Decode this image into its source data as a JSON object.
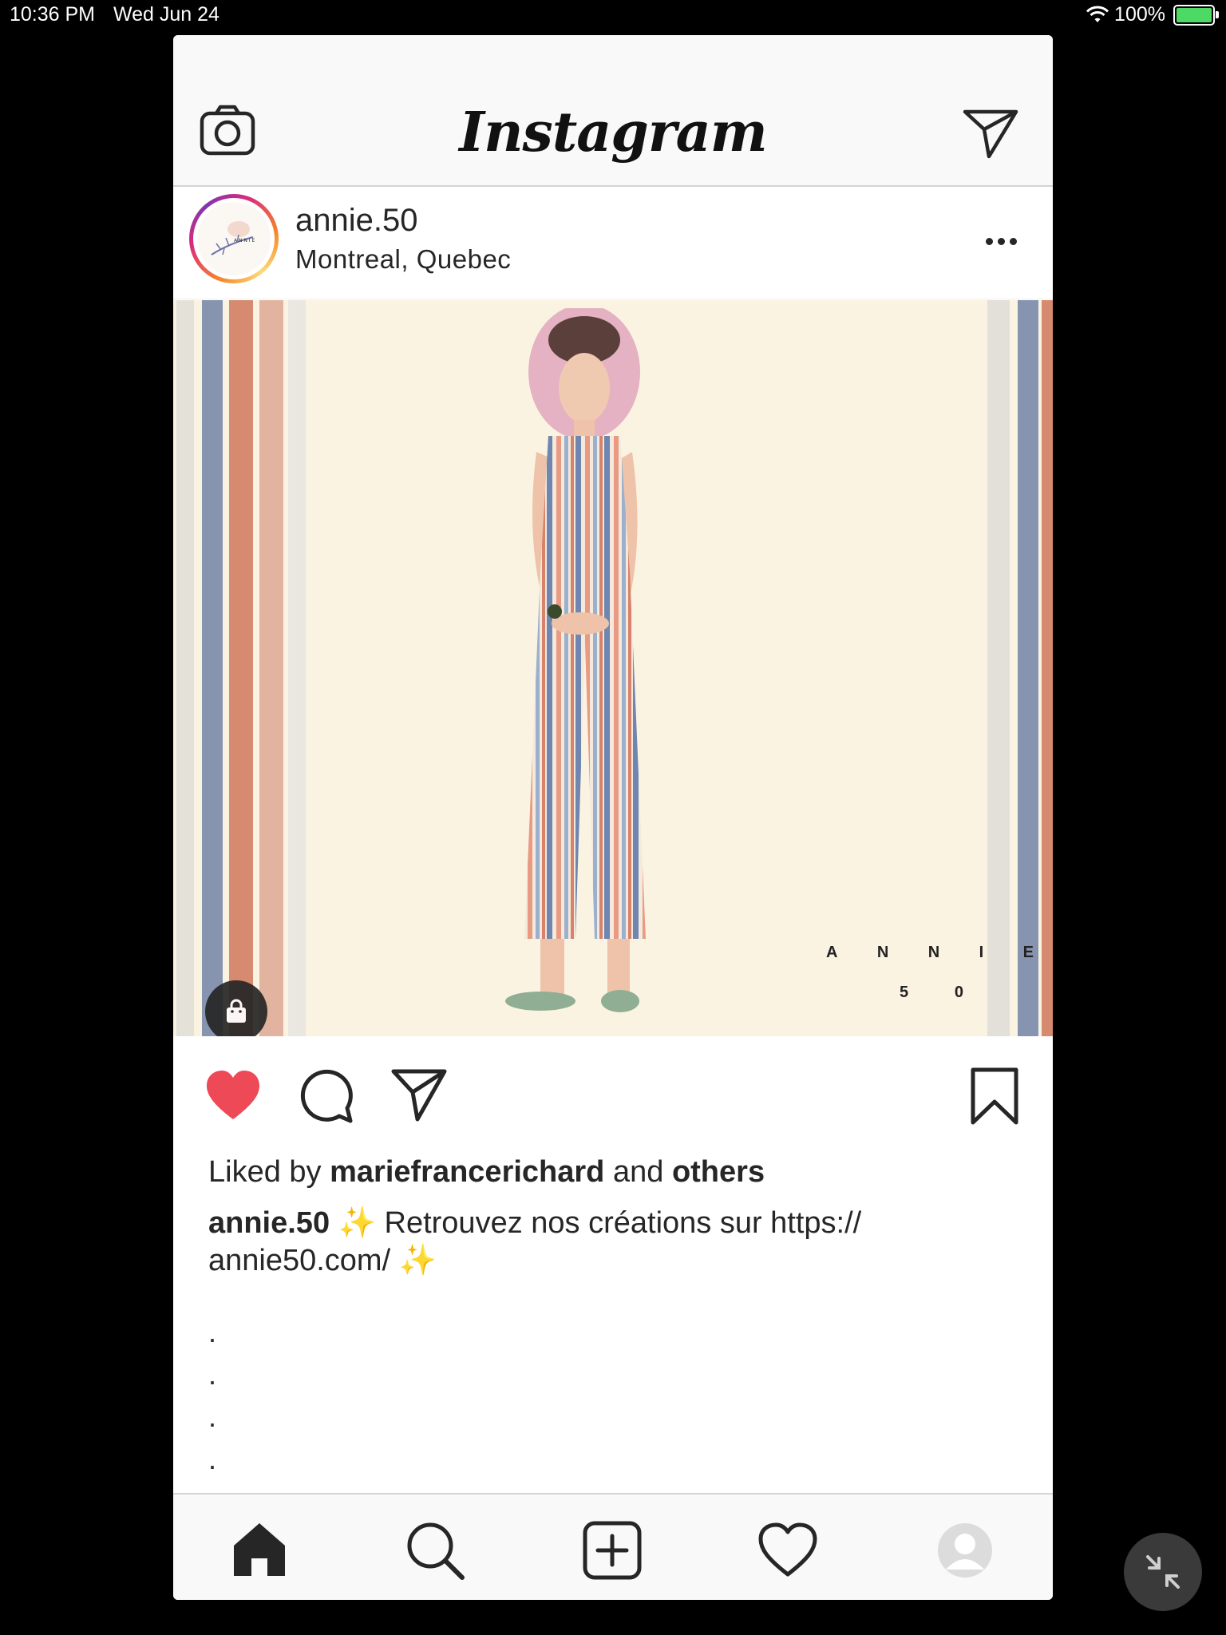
{
  "status_bar": {
    "time": "10:36 PM",
    "date": "Wed Jun 24",
    "battery_text": "100%"
  },
  "app": {
    "logo": "Instagram",
    "icons": {
      "camera": "camera-icon",
      "direct": "paper-plane-icon"
    }
  },
  "post": {
    "username": "annie.50",
    "location": "Montreal, Quebec",
    "image_brand_letters_row1": [
      "A",
      "N",
      "N",
      "I",
      "E"
    ],
    "image_brand_letters_row2": [
      "5",
      "0"
    ],
    "liked_prefix": "Liked by",
    "liked_user": "mariefrancerichard",
    "liked_and": "and",
    "liked_others": "others",
    "caption_user": "annie.50",
    "caption_text": "✨ Retrouvez nos créations sur https:// annie50.com/ ✨",
    "caption_dots": [
      ".",
      ".",
      ".",
      ".",
      "."
    ],
    "is_liked": true
  },
  "tabbar": {
    "items": [
      "home-icon",
      "search-icon",
      "new-post-icon",
      "activity-heart-icon",
      "profile-icon"
    ]
  },
  "colors": {
    "like_red": "#ed4956",
    "text": "#262626",
    "bar_bg": "#f9f9f9"
  }
}
